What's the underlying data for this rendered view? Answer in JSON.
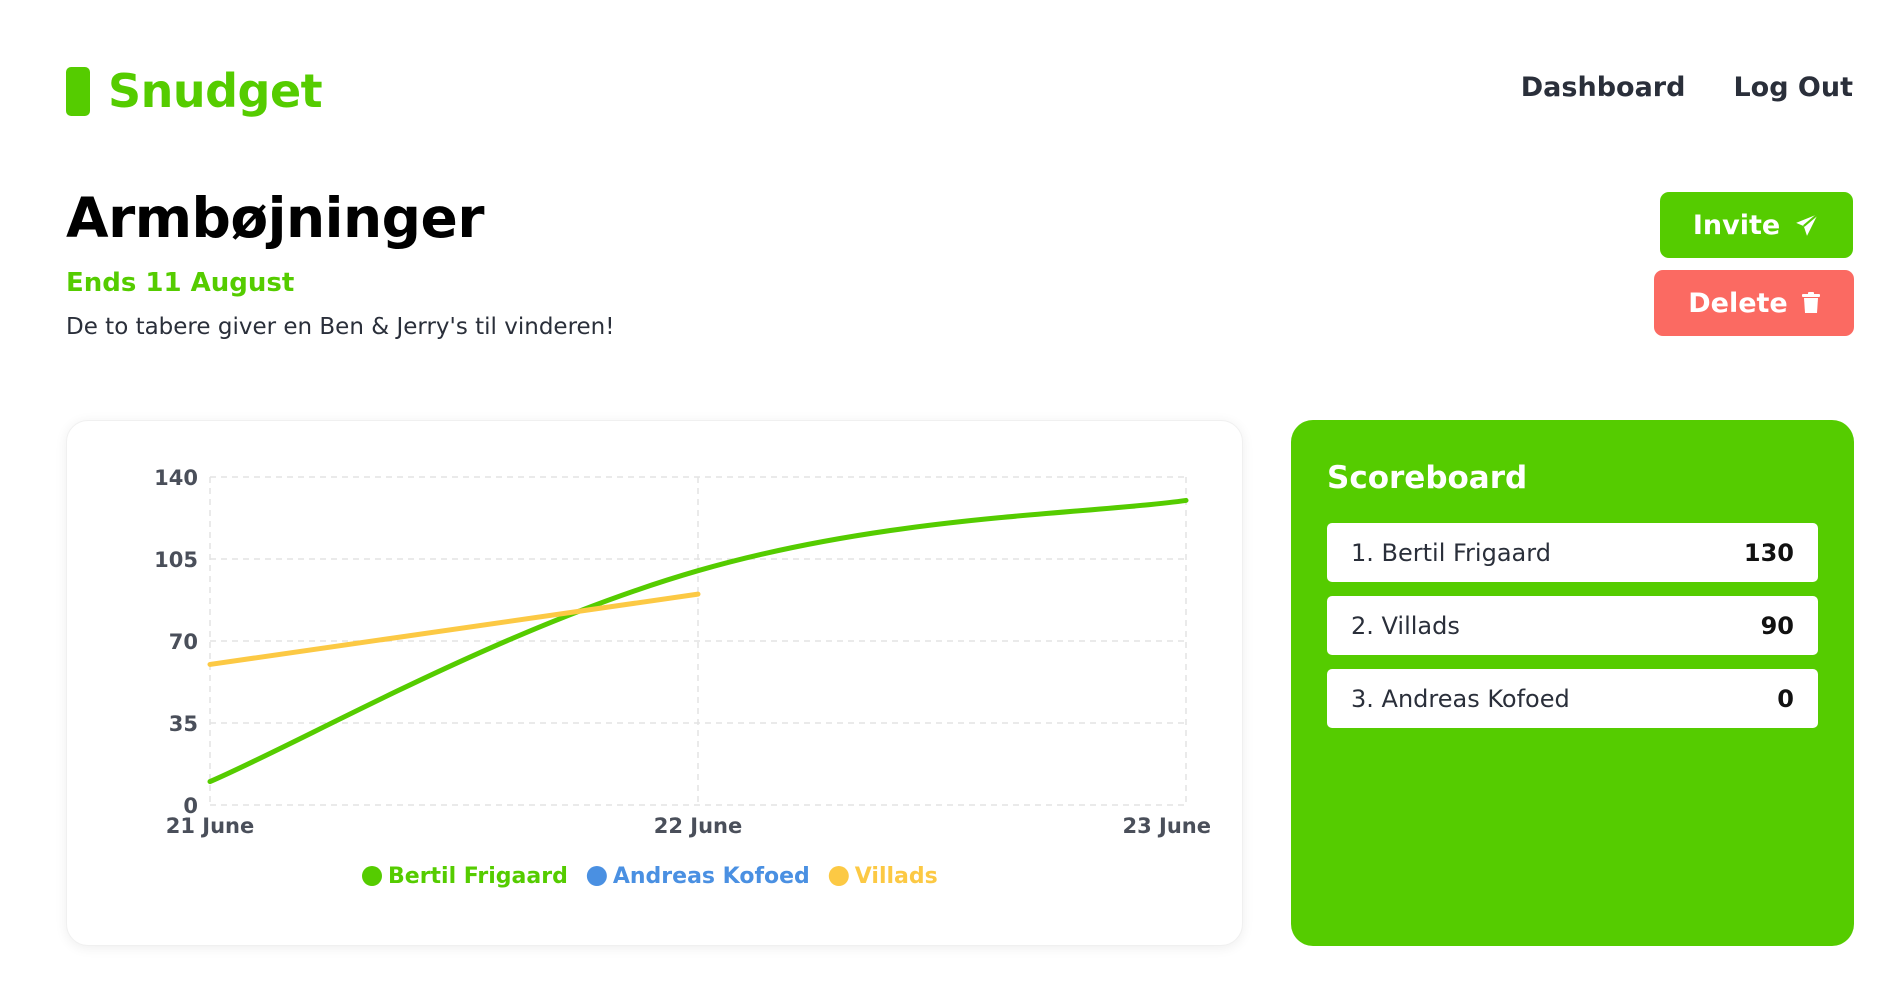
{
  "brand": {
    "name": "Snudget",
    "color": "#55cc00"
  },
  "nav": {
    "dashboard": "Dashboard",
    "logout": "Log Out"
  },
  "challenge": {
    "title": "Armbøjninger",
    "ends": "Ends 11 August",
    "description": "De to tabere giver en Ben & Jerry's til vinderen!"
  },
  "actions": {
    "invite": "Invite",
    "delete": "Delete",
    "invite_icon": "paper-plane-icon",
    "delete_icon": "trash-icon"
  },
  "scoreboard": {
    "title": "Scoreboard",
    "rows": [
      {
        "name": "1. Bertil Frigaard",
        "score": "130"
      },
      {
        "name": "2. Villads",
        "score": "90"
      },
      {
        "name": "3. Andreas Kofoed",
        "score": "0"
      }
    ]
  },
  "chart_data": {
    "type": "line",
    "categories": [
      "21 June",
      "22 June",
      "23 June"
    ],
    "yticks": [
      0,
      35,
      70,
      105,
      140
    ],
    "ylim": [
      0,
      140
    ],
    "grid": true,
    "legend_position": "bottom",
    "series": [
      {
        "name": "Bertil Frigaard",
        "color": "#55cc00",
        "values": [
          10,
          100,
          130
        ]
      },
      {
        "name": "Andreas Kofoed",
        "color": "#4a90e2",
        "values": []
      },
      {
        "name": "Villads",
        "color": "#fcc944",
        "values": [
          60,
          90
        ]
      }
    ]
  }
}
